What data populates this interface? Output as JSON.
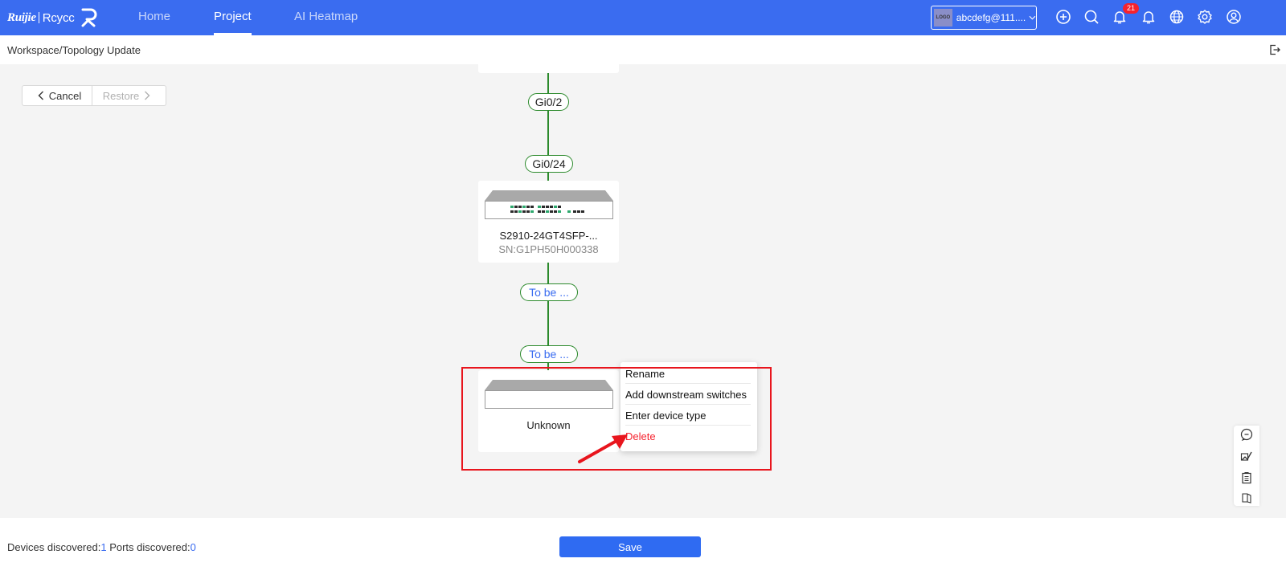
{
  "nav": {
    "brand_name": "Ruijie",
    "brand_product": "Rcycc",
    "items": [
      {
        "label": "Home",
        "active": false
      },
      {
        "label": "Project",
        "active": true
      },
      {
        "label": "AI Heatmap",
        "active": false
      }
    ],
    "account": {
      "logo_text": "LOGO",
      "label": "abcdefg@111...."
    },
    "notification_count": "21",
    "icons": [
      "plus-circle-icon",
      "search-icon",
      "bell-icon",
      "bell-icon",
      "globe-icon",
      "gear-icon",
      "user-icon"
    ]
  },
  "breadcrumb": "Workspace/Topology Update",
  "toolbar": {
    "cancel_label": "Cancel",
    "restore_label": "Restore"
  },
  "topology": {
    "links": [
      {
        "upper_port": "Gi0/2",
        "lower_port": "Gi0/24"
      },
      {
        "upper_port": "To be ...",
        "lower_port": "To be ..."
      }
    ],
    "devices": [
      {
        "name": "S2910-24GT4SFP-...",
        "sn": "SN:G1PH50H000338"
      },
      {
        "name": "Unknown",
        "sn": ""
      }
    ]
  },
  "context_menu": {
    "items": [
      "Rename",
      "Add downstream switches",
      "Enter device type",
      "Delete"
    ],
    "danger_color": "#f5222d"
  },
  "footer": {
    "devices_label": "Devices discovered:",
    "devices_count": "1",
    "ports_label": "Ports discovered:",
    "ports_count": "0",
    "save_label": "Save"
  },
  "colors": {
    "primary": "#3a6cf0",
    "link_line": "#2c8a2c",
    "highlight": "#e8151d"
  }
}
